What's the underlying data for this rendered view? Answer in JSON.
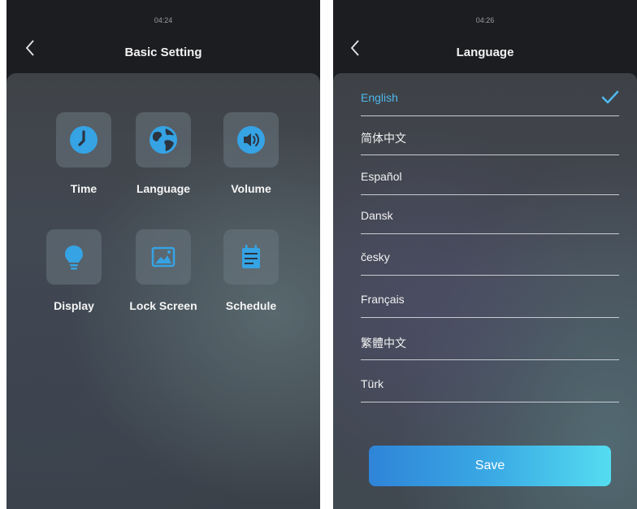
{
  "basic_setting_screen": {
    "status_time": "04:24",
    "title": "Basic Setting",
    "tiles": [
      {
        "label": "Time",
        "icon": "clock-icon"
      },
      {
        "label": "Language",
        "icon": "globe-icon"
      },
      {
        "label": "Volume",
        "icon": "speaker-icon"
      },
      {
        "label": "Display",
        "icon": "lightbulb-icon"
      },
      {
        "label": "Lock Screen",
        "icon": "image-icon"
      },
      {
        "label": "Schedule",
        "icon": "calendar-icon"
      }
    ]
  },
  "language_screen": {
    "status_time": "04:26",
    "title": "Language",
    "selected_index": 0,
    "languages": [
      {
        "label": "English"
      },
      {
        "label": "简体中文"
      },
      {
        "label": "Español"
      },
      {
        "label": "Dansk"
      },
      {
        "label": "česky"
      },
      {
        "label": "Français"
      },
      {
        "label": "繁體中文"
      },
      {
        "label": "Türk"
      }
    ],
    "save_label": "Save"
  },
  "colors": {
    "accent": "#3aa9e4",
    "selected_text": "#4fb8ec",
    "icon_blue": "#35a3e4"
  }
}
